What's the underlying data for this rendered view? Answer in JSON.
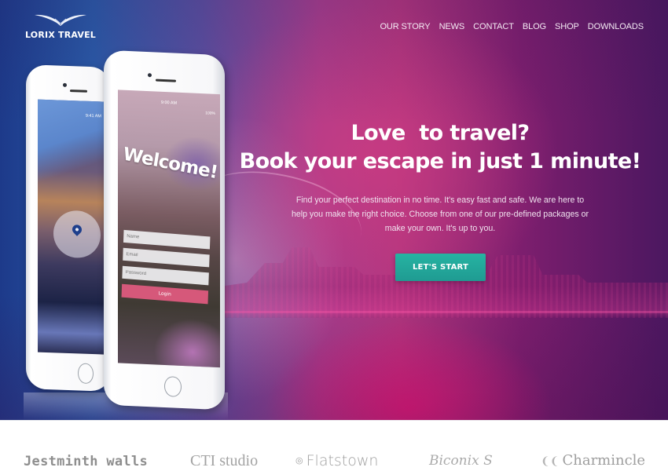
{
  "brand": {
    "name": "LORIX TRAVEL",
    "logo_icon": "wing-logo-icon"
  },
  "nav": {
    "items": [
      {
        "label": "OUR STORY"
      },
      {
        "label": "NEWS"
      },
      {
        "label": "CONTACT"
      },
      {
        "label": "BLOG"
      },
      {
        "label": "SHOP"
      },
      {
        "label": "DOWNLOADS"
      }
    ]
  },
  "hero": {
    "headline_line1": "Love  to travel?",
    "headline_line2": "Book your escape in just 1 minute!",
    "description": "Find your perfect destination in no time. It's easy fast and safe. We are here to help you make the right choice. Choose from one of our pre-defined packages or make your own. It's up to you.",
    "cta_label": "LET'S START"
  },
  "phones": {
    "back": {
      "status_time": "9:41 AM",
      "icon": "location-pin-icon"
    },
    "front": {
      "status_time": "9:00 AM",
      "battery": "100%",
      "welcome_text": "Welcome!",
      "form": {
        "name_placeholder": "Name",
        "email_placeholder": "Email",
        "password_placeholder": "Password",
        "login_label": "Login"
      }
    }
  },
  "partners": {
    "items": [
      {
        "label": "Jestminth walls"
      },
      {
        "label": "CTI studio"
      },
      {
        "label": "Flatstown",
        "mark": "◎"
      },
      {
        "label": "Biconix S"
      },
      {
        "label": "Charmincle",
        "mark": "❨❨"
      }
    ]
  },
  "colors": {
    "cta": "#21a89a",
    "login_button": "#d6587a",
    "hero_pink": "#e0167a",
    "hero_purple": "#4b1760",
    "hero_blue": "#1d3a8a"
  }
}
